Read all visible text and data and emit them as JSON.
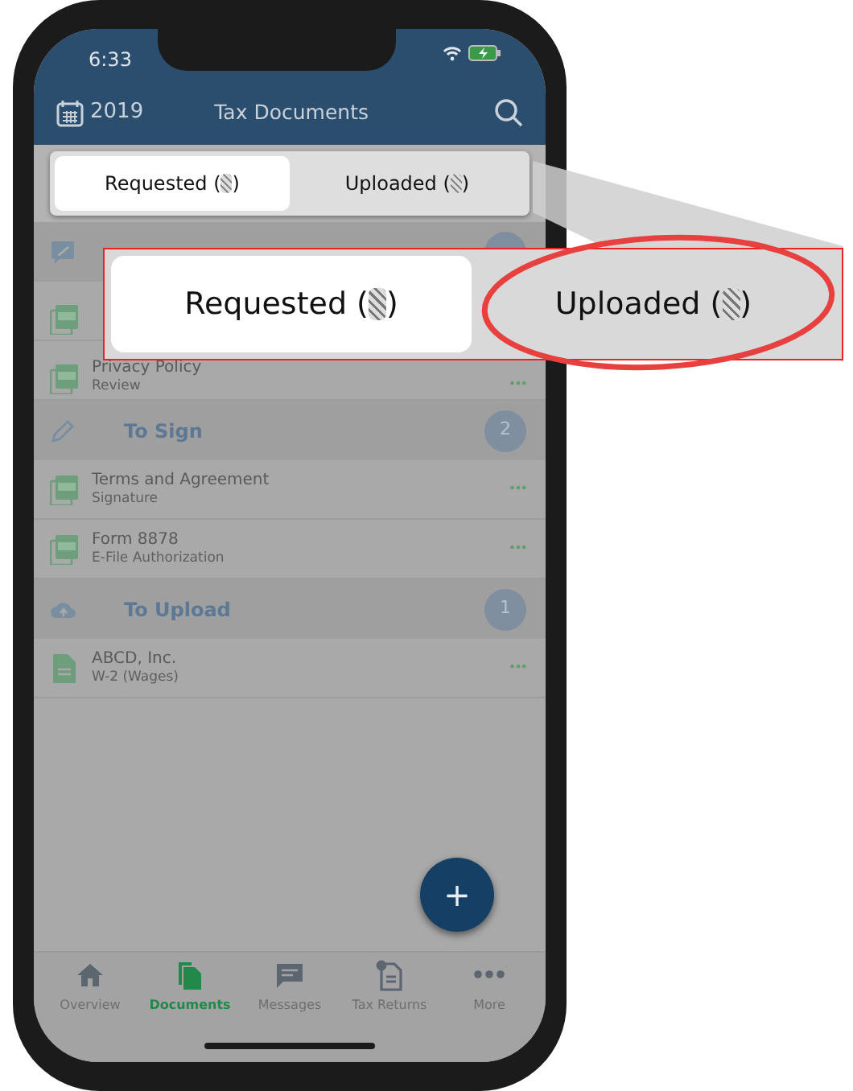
{
  "status_bar": {
    "time": "6:33"
  },
  "header": {
    "year": "2019",
    "title": "Tax Documents"
  },
  "segments": [
    {
      "label": "Requested (",
      "close": ")",
      "selected": true
    },
    {
      "label": "Uploaded (",
      "close": ")",
      "selected": false
    }
  ],
  "sections": [
    {
      "kind": "request",
      "rows": [
        {
          "kind": "pdf"
        },
        {
          "kind": "pdf",
          "title": "Privacy Policy",
          "subtitle": "Review",
          "menu": "•••"
        }
      ]
    },
    {
      "kind": "sign",
      "title": "To Sign",
      "count": "2",
      "rows": [
        {
          "kind": "pdf",
          "title": "Terms and Agreement",
          "subtitle": "Signature",
          "menu": "•••"
        },
        {
          "kind": "pdf",
          "title": "Form 8878",
          "subtitle": "E-File Authorization",
          "menu": "•••"
        }
      ]
    },
    {
      "kind": "upload",
      "title": "To Upload",
      "count": "1",
      "rows": [
        {
          "kind": "doc",
          "title": "ABCD, Inc.",
          "subtitle": "W-2 (Wages)",
          "menu": "•••"
        }
      ]
    }
  ],
  "fab": {
    "label": "+"
  },
  "tab_bar": [
    {
      "kind": "home",
      "label": "Overview",
      "selected": false
    },
    {
      "kind": "docs",
      "label": "Documents",
      "selected": true
    },
    {
      "kind": "chat",
      "label": "Messages",
      "selected": false
    },
    {
      "kind": "returns",
      "label": "Tax Returns",
      "selected": false
    },
    {
      "kind": "more",
      "label": "More",
      "selected": false
    }
  ],
  "callout": {
    "segments": [
      {
        "label": "Requested (",
        "close": ")",
        "selected": true
      },
      {
        "label": "Uploaded (",
        "close": ")",
        "selected": false,
        "circled": true
      }
    ]
  }
}
